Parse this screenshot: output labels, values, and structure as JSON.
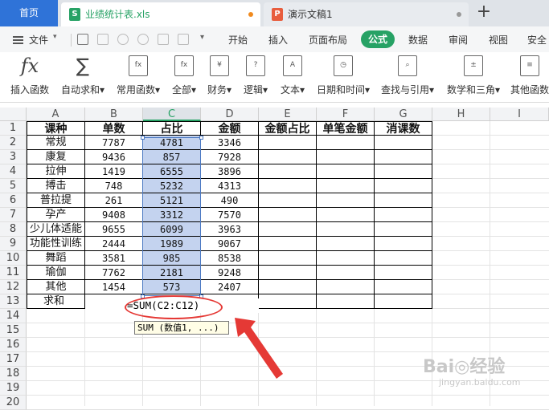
{
  "tabs": {
    "home": "首页",
    "file": {
      "label": "业绩统计表.xls",
      "icon": "spreadsheet-icon",
      "badge": "S"
    },
    "ppt": {
      "label": "演示文稿1",
      "icon": "presentation-icon",
      "badge": "P"
    },
    "new_tab": "+"
  },
  "menu": {
    "file_label": "文件",
    "tabs": [
      "开始",
      "插入",
      "页面布局",
      "公式",
      "数据",
      "审阅",
      "视图",
      "安全"
    ],
    "active_tab": "公式"
  },
  "ribbon": [
    {
      "label": "插入函数",
      "icon": "fx-icon"
    },
    {
      "label": "自动求和▾",
      "icon": "sigma-icon"
    },
    {
      "label": "常用函数▾",
      "icon": "function-star-icon"
    },
    {
      "label": "全部▾",
      "icon": "function-all-icon"
    },
    {
      "label": "财务▾",
      "icon": "finance-icon"
    },
    {
      "label": "逻辑▾",
      "icon": "logic-icon"
    },
    {
      "label": "文本▾",
      "icon": "text-function-icon"
    },
    {
      "label": "日期和时间▾",
      "icon": "clock-icon"
    },
    {
      "label": "查找与引用▾",
      "icon": "lookup-icon"
    },
    {
      "label": "数学和三角▾",
      "icon": "math-icon"
    },
    {
      "label": "其他函数",
      "icon": "more-functions-icon"
    }
  ],
  "columns": [
    "A",
    "B",
    "C",
    "D",
    "E",
    "F",
    "G",
    "H",
    "I"
  ],
  "rows": [
    "1",
    "2",
    "3",
    "4",
    "5",
    "6",
    "7",
    "8",
    "9",
    "10",
    "11",
    "12",
    "13",
    "14",
    "15",
    "16",
    "17",
    "18",
    "19",
    "20"
  ],
  "table": {
    "headers": [
      "课种",
      "单数",
      "占比",
      "金额",
      "金额占比",
      "单笔金额",
      "消课数"
    ],
    "data": [
      [
        "常规",
        "7787",
        "4781",
        "3346"
      ],
      [
        "康复",
        "9436",
        "857",
        "7928"
      ],
      [
        "拉伸",
        "1419",
        "6555",
        "3896"
      ],
      [
        "搏击",
        "748",
        "5232",
        "4313"
      ],
      [
        "普拉提",
        "261",
        "5121",
        "490"
      ],
      [
        "孕产",
        "9408",
        "3312",
        "7570"
      ],
      [
        "少儿体适能",
        "9655",
        "6099",
        "3963"
      ],
      [
        "功能性训练",
        "2444",
        "1989",
        "9067"
      ],
      [
        "舞蹈",
        "3581",
        "985",
        "8538"
      ],
      [
        "瑜伽",
        "7762",
        "2181",
        "9248"
      ],
      [
        "其他",
        "1454",
        "573",
        "2407"
      ]
    ],
    "sum_label": "求和",
    "formula": "=SUM(C2:C12)",
    "tooltip": "SUM (数值1, ...)"
  },
  "watermark": {
    "main": "Bai◎经验",
    "sub": "jingyan.baidu.com"
  },
  "colors": {
    "accent_green": "#27a265",
    "selection_fill": "#c4d3ef",
    "highlight_red": "#e53935",
    "home_tab": "#2f73d8"
  }
}
